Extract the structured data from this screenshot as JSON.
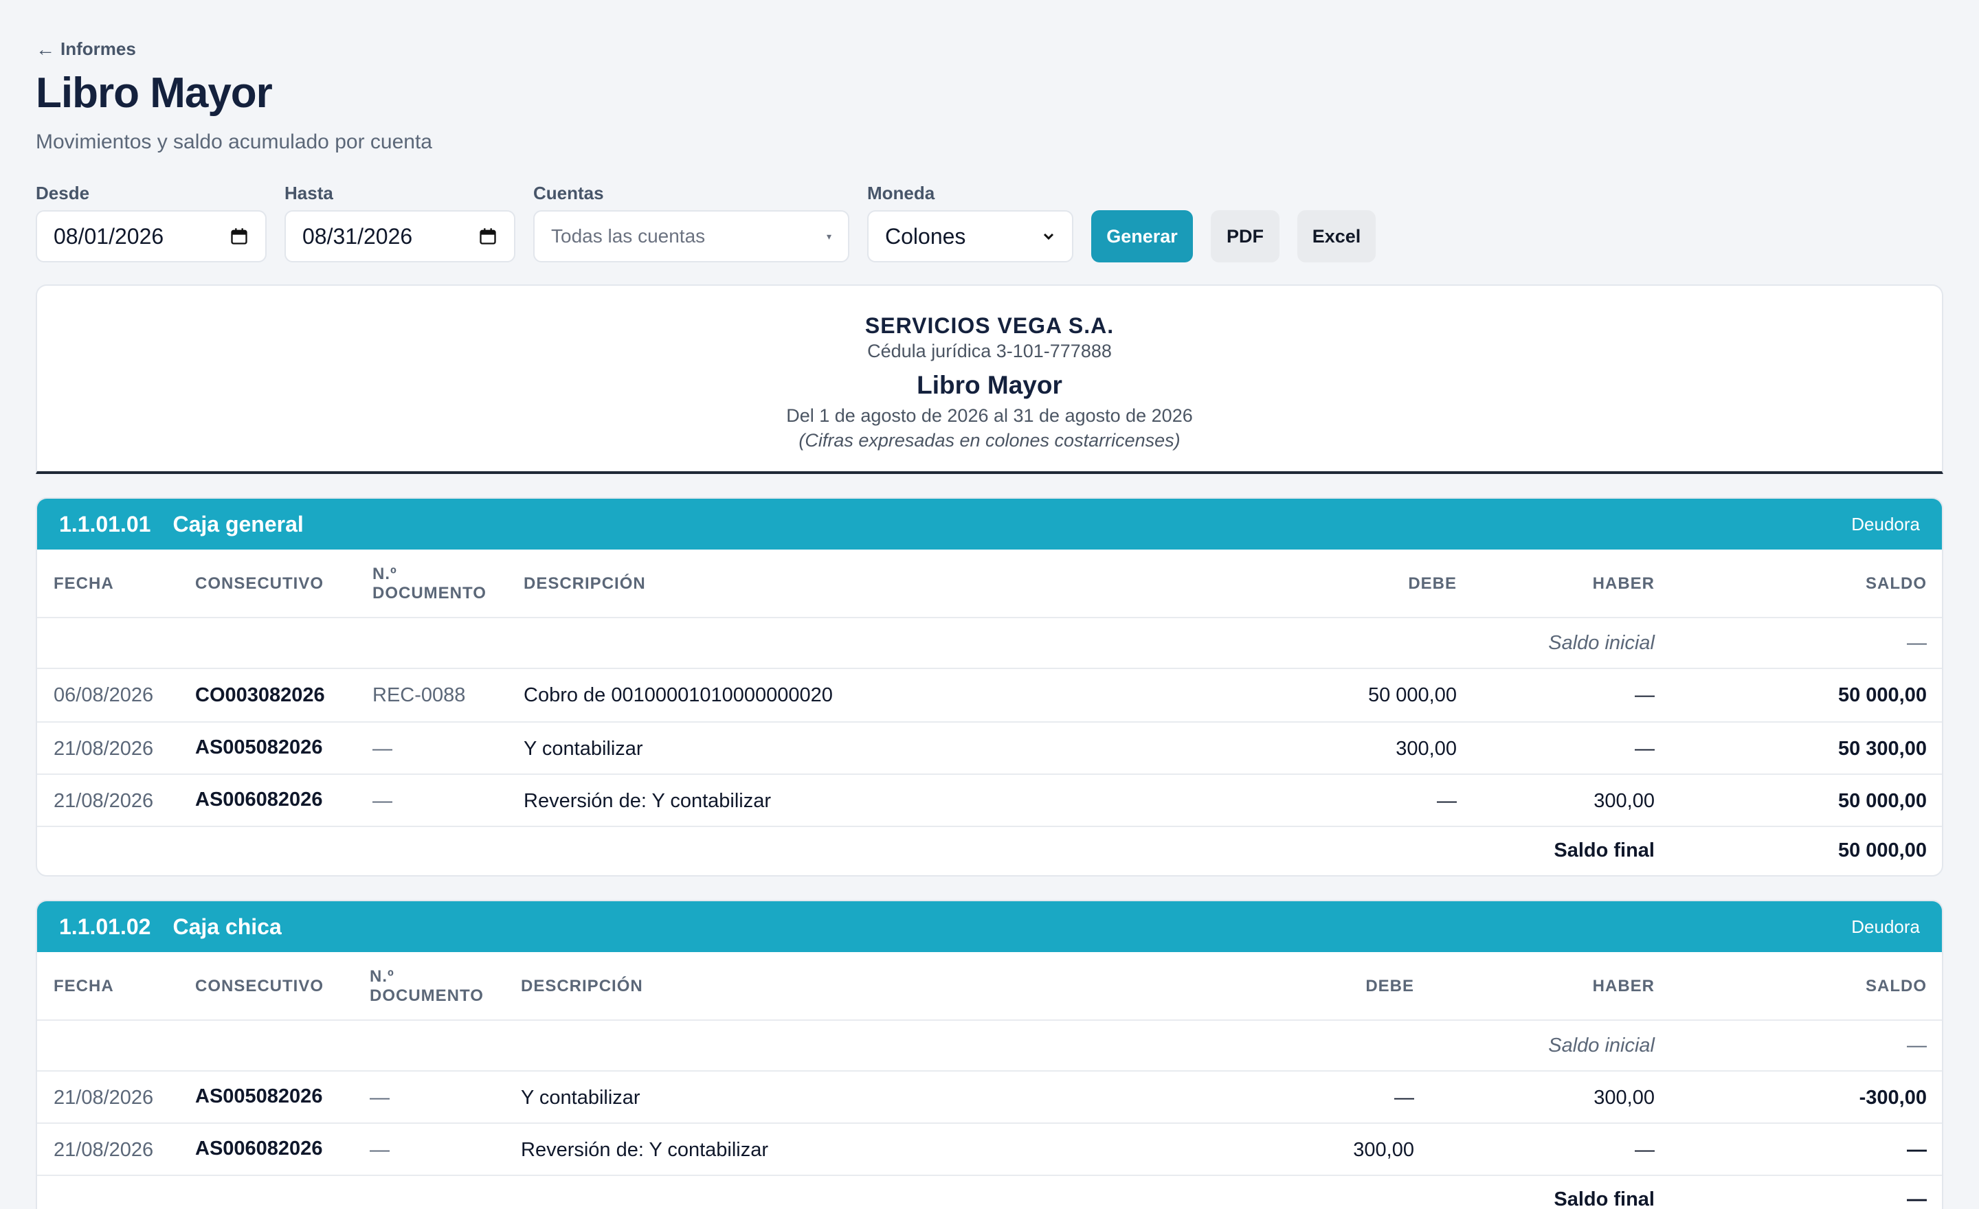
{
  "nav": {
    "back_label": "Informes"
  },
  "header": {
    "title": "Libro Mayor",
    "subtitle": "Movimientos y saldo acumulado por cuenta"
  },
  "filters": {
    "desde_label": "Desde",
    "desde_value": "08/01/2026",
    "hasta_label": "Hasta",
    "hasta_value": "08/31/2026",
    "cuentas_label": "Cuentas",
    "cuentas_placeholder": "Todas las cuentas",
    "moneda_label": "Moneda",
    "moneda_value": "Colones",
    "generar_label": "Generar",
    "pdf_label": "PDF",
    "excel_label": "Excel"
  },
  "colors": {
    "accent": "#1a9bb8",
    "account_header": "#1aa8c4"
  },
  "report": {
    "company": "SERVICIOS VEGA S.A.",
    "cedula": "Cédula jurídica 3-101-777888",
    "title": "Libro Mayor",
    "period": "Del 1 de agosto de 2026 al 31 de agosto de 2026",
    "note": "(Cifras expresadas en colones costarricenses)"
  },
  "table_headers": {
    "fecha": "FECHA",
    "consecutivo": "CONSECUTIVO",
    "doc_line1": "N.º",
    "doc_line2": "DOCUMENTO",
    "descripcion": "DESCRIPCIÓN",
    "debe": "DEBE",
    "haber": "HABER",
    "saldo": "SALDO"
  },
  "labels": {
    "saldo_inicial": "Saldo inicial",
    "saldo_final": "Saldo final"
  },
  "accounts": [
    {
      "code": "1.1.01.01",
      "name": "Caja general",
      "nature": "Deudora",
      "opening_balance": "—",
      "rows": [
        {
          "fecha": "06/08/2026",
          "consecutivo": "CO003082026",
          "documento": "REC-0088",
          "descripcion": "Cobro de 00100001010000000020",
          "debe": "50 000,00",
          "haber": "—",
          "saldo": "50 000,00"
        },
        {
          "fecha": "21/08/2026",
          "consecutivo": "AS005082026",
          "documento": "—",
          "descripcion": "Y contabilizar",
          "debe": "300,00",
          "haber": "—",
          "saldo": "50 300,00"
        },
        {
          "fecha": "21/08/2026",
          "consecutivo": "AS006082026",
          "documento": "—",
          "descripcion": "Reversión de: Y contabilizar",
          "debe": "—",
          "haber": "300,00",
          "saldo": "50 000,00"
        }
      ],
      "closing_balance": "50 000,00"
    },
    {
      "code": "1.1.01.02",
      "name": "Caja chica",
      "nature": "Deudora",
      "opening_balance": "—",
      "rows": [
        {
          "fecha": "21/08/2026",
          "consecutivo": "AS005082026",
          "documento": "—",
          "descripcion": "Y contabilizar",
          "debe": "—",
          "haber": "300,00",
          "saldo": "-300,00"
        },
        {
          "fecha": "21/08/2026",
          "consecutivo": "AS006082026",
          "documento": "—",
          "descripcion": "Reversión de: Y contabilizar",
          "debe": "300,00",
          "haber": "—",
          "saldo": "—"
        }
      ],
      "closing_balance": "—"
    }
  ]
}
